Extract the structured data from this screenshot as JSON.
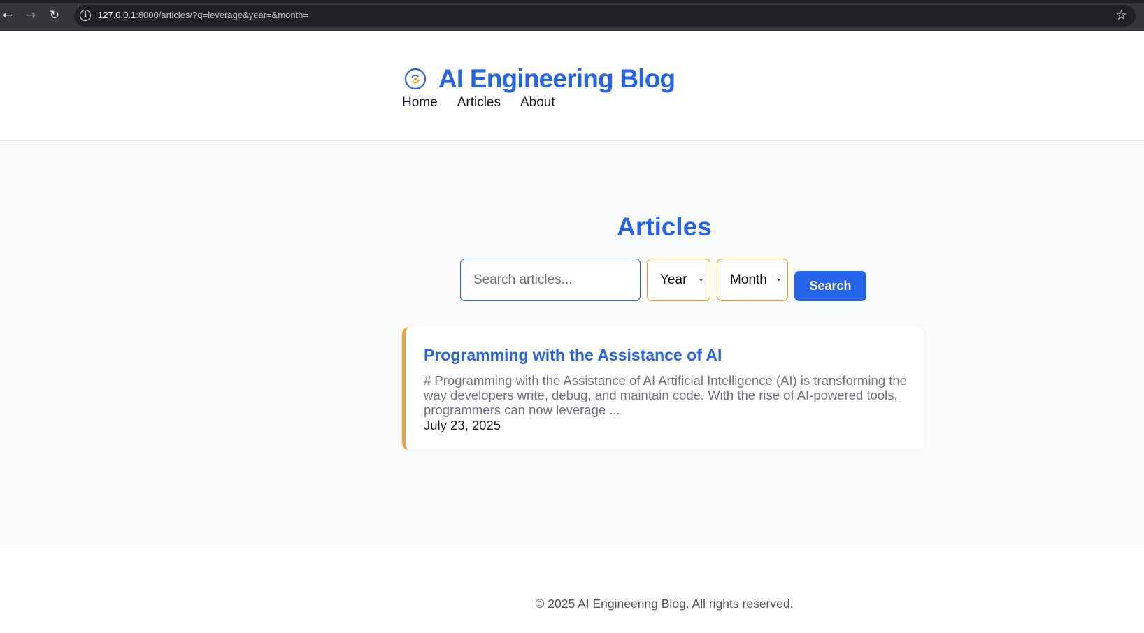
{
  "browser": {
    "url_host": "127.0.0.1",
    "url_path": ":8000/articles/?q=leverage&year=&month="
  },
  "header": {
    "site_title": "AI Engineering Blog",
    "nav": [
      "Home",
      "Articles",
      "About"
    ]
  },
  "main": {
    "page_title": "Articles",
    "search_placeholder": "Search articles...",
    "search_value": "",
    "year_select": "Year",
    "month_select": "Month",
    "search_button": "Search",
    "articles": [
      {
        "title": "Programming with the Assistance of AI",
        "excerpt": "# Programming with the Assistance of AI Artificial Intelligence (AI) is transforming the way developers write, debug, and maintain code. With the rise of AI-powered tools, programmers can now leverage ...",
        "date": "July 23, 2025"
      }
    ]
  },
  "footer": {
    "copyright": "© 2025 AI Engineering Blog. All rights reserved."
  },
  "colors": {
    "primary": "#2563eb",
    "accent": "#f59e0b",
    "card_border": "#f0a232"
  }
}
